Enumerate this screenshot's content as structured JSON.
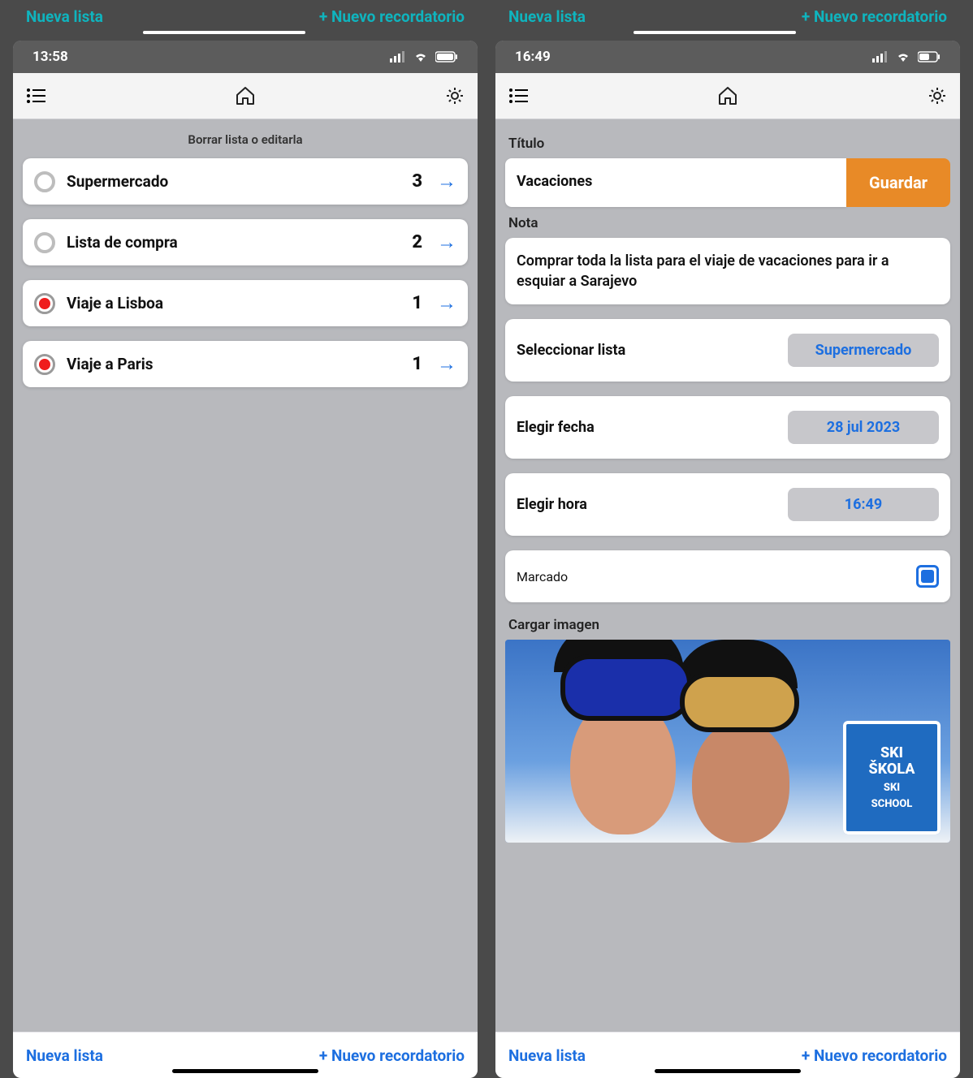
{
  "floating": {
    "new_list": "Nueva lista",
    "new_reminder": "+ Nuevo recordatorio"
  },
  "footer": {
    "new_list": "Nueva lista",
    "new_reminder": "+ Nuevo recordatorio"
  },
  "left": {
    "time": "13:58",
    "hint": "Borrar lista o editarla",
    "lists": [
      {
        "title": "Supermercado",
        "count": "3",
        "red": false
      },
      {
        "title": "Lista de compra",
        "count": "2",
        "red": false
      },
      {
        "title": "Viaje a Lisboa",
        "count": "1",
        "red": true
      },
      {
        "title": "Viaje a Paris",
        "count": "1",
        "red": true
      }
    ]
  },
  "right": {
    "time": "16:49",
    "labels": {
      "title": "Título",
      "note": "Nota",
      "select_list": "Seleccionar lista",
      "pick_date": "Elegir fecha",
      "pick_time": "Elegir hora",
      "marked": "Marcado",
      "load_image": "Cargar imagen"
    },
    "title_value": "Vacaciones",
    "save": "Guardar",
    "note_value": "Comprar toda la lista para el viaje de vacaciones para ir a esquiar a Sarajevo",
    "list_value": "Supermercado",
    "date_value": "28 jul 2023",
    "time_value": "16:49",
    "marked": true,
    "sign": {
      "line1": "SKI",
      "line2": "ŠKOLA",
      "line3": "SKI",
      "line4": "SCHOOL"
    }
  }
}
